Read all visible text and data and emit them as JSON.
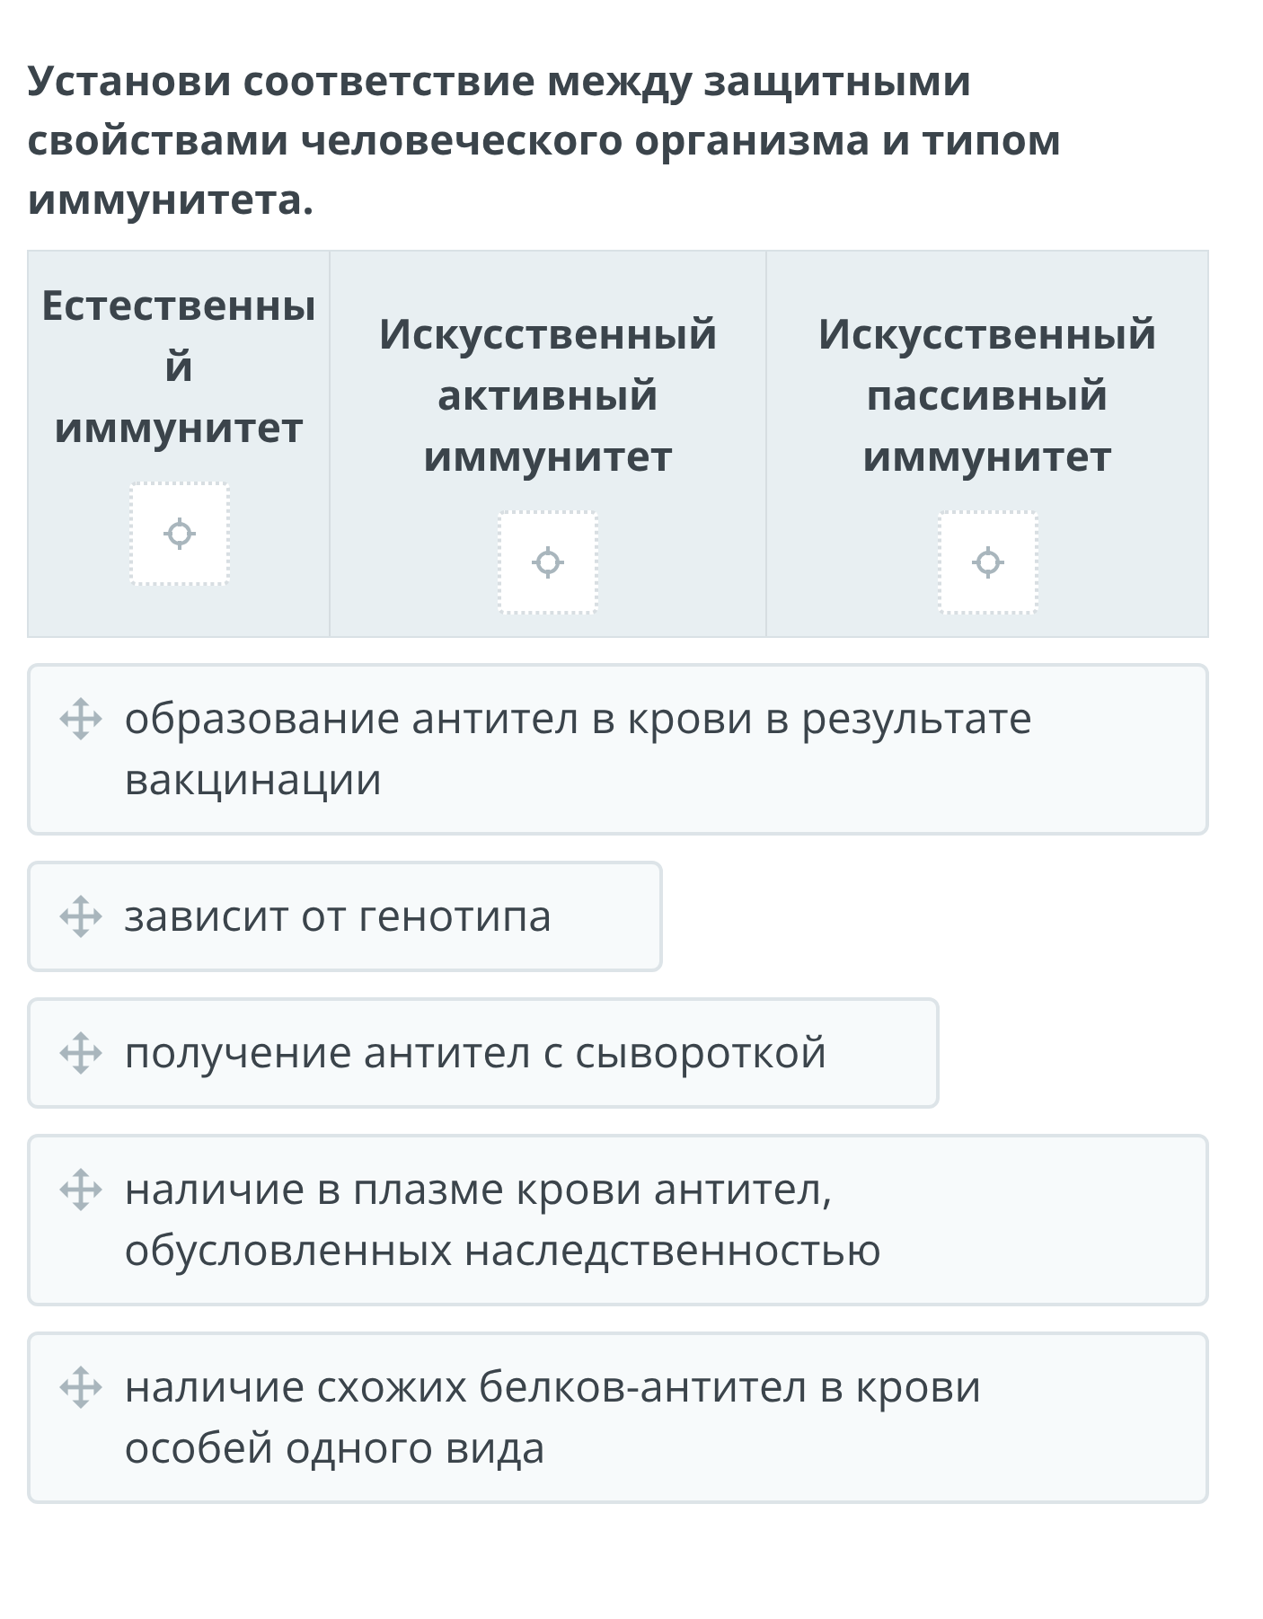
{
  "question": "Установи соответствие между защитными свойствами человеческого организма и типом иммунитета.",
  "columns": [
    {
      "heading": "Естественный иммунитет"
    },
    {
      "heading": "Искусственный активный иммунитет"
    },
    {
      "heading": "Искусственный пассивный иммунитет"
    }
  ],
  "items": [
    {
      "text": "образование антител в крови в результате вакцинации"
    },
    {
      "text": "зависит от генотипа"
    },
    {
      "text": "получение антител с сывороткой"
    },
    {
      "text": "наличие в плазме крови антител, обусловленных наследственностью"
    },
    {
      "text": "наличие схожих белков-антител в крови особей одного вида"
    }
  ]
}
